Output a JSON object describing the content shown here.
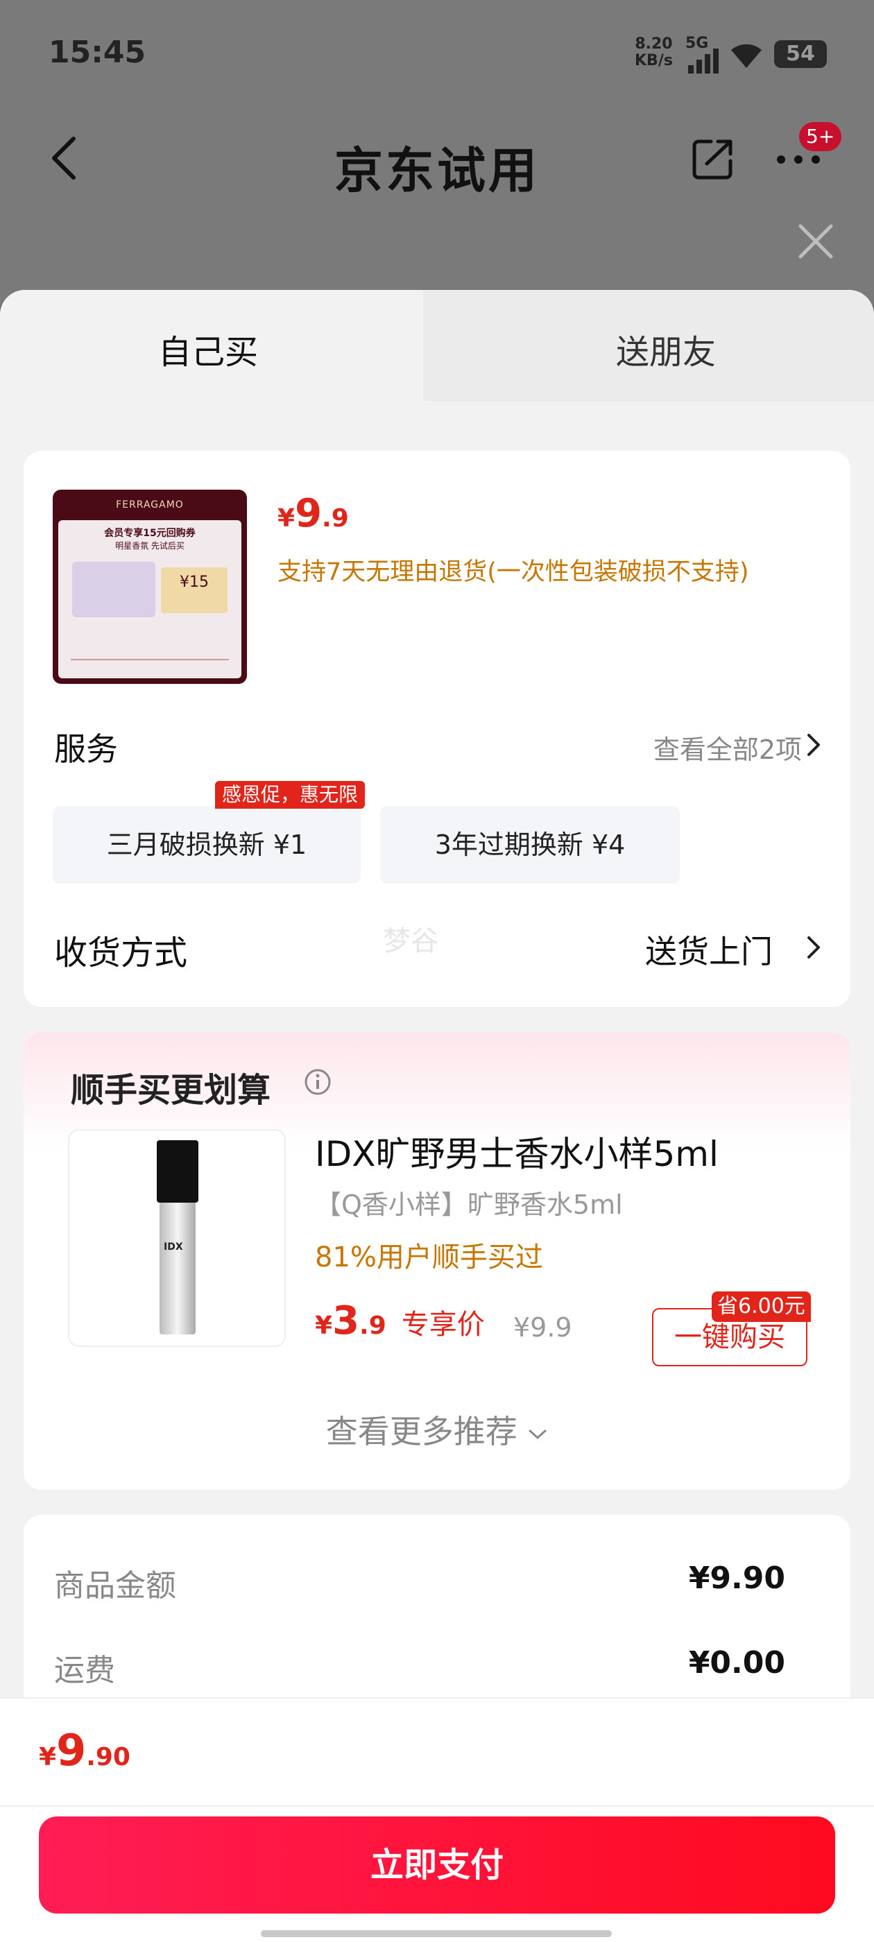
{
  "status": {
    "time": "15:45",
    "net_speed_value": "8.20",
    "net_speed_unit": "KB/s",
    "network": "5G",
    "battery": "54"
  },
  "nav": {
    "title": "京东试用",
    "badge": "5+"
  },
  "tabs": [
    {
      "label": "自己买"
    },
    {
      "label": "送朋友"
    }
  ],
  "product": {
    "image_text": {
      "brand": "FERRAGAMO",
      "title": "会员专享15元回购券",
      "subtitle": "明星香氛 先试后买",
      "coupon": "¥15"
    },
    "price": {
      "symbol": "¥",
      "int": "9",
      "dec": ".9"
    },
    "return_note": "支持7天无理由退货(一次性包装破损不支持)"
  },
  "service": {
    "title": "服务",
    "more": "查看全部2项",
    "chips": [
      {
        "label": "三月破损换新  ¥1"
      },
      {
        "label": "3年过期换新  ¥4"
      }
    ],
    "promo_badge": "感恩促，惠无限"
  },
  "delivery": {
    "title": "收货方式",
    "value": "送货上门",
    "watermark": "梦谷"
  },
  "upsell": {
    "title": "顺手买更划算",
    "item": {
      "image_label": "IDX",
      "name": "IDX旷野男士香水小样5ml",
      "sub": "【Q香小样】旷野香水5ml",
      "pct": "81%用户顺手买过",
      "price_symbol": "¥",
      "price_int": "3",
      "price_dec": ".9",
      "price_label": "专享价",
      "orig": "¥9.9",
      "buy_label": "一键购买",
      "save": "省6.00元"
    },
    "see_more": "查看更多推荐"
  },
  "summary": [
    {
      "label": "商品金额",
      "value": "¥9.90"
    },
    {
      "label": "运费",
      "value": "¥0.00"
    }
  ],
  "footer": {
    "total_symbol": "¥",
    "total_int": "9",
    "total_dec": ".90",
    "pay_label": "立即支付"
  },
  "colors": {
    "accent_red": "#e1251b",
    "orange": "#c77600",
    "pay_gradient_start": "#ff1d55",
    "pay_gradient_end": "#ff0a1f"
  }
}
